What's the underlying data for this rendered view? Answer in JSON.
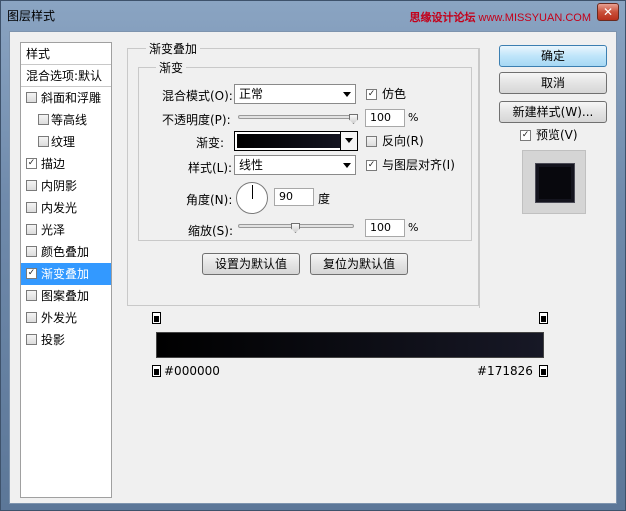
{
  "window": {
    "title": "图层样式",
    "watermark_cn": "思缘设计论坛",
    "watermark_domain": "www.MISSYUAN.COM",
    "close_glyph": "✕"
  },
  "style_list": {
    "header": "样式",
    "blend_options": "混合选项:默认",
    "items": [
      {
        "label": "斜面和浮雕",
        "checked": false
      },
      {
        "label": "等高线",
        "checked": false,
        "sub": true
      },
      {
        "label": "纹理",
        "checked": false,
        "sub": true
      },
      {
        "label": "描边",
        "checked": true
      },
      {
        "label": "内阴影",
        "checked": false
      },
      {
        "label": "内发光",
        "checked": false
      },
      {
        "label": "光泽",
        "checked": false
      },
      {
        "label": "颜色叠加",
        "checked": false
      },
      {
        "label": "渐变叠加",
        "checked": true,
        "active": true
      },
      {
        "label": "图案叠加",
        "checked": false
      },
      {
        "label": "外发光",
        "checked": false
      },
      {
        "label": "投影",
        "checked": false
      }
    ]
  },
  "panel": {
    "outer_title": "渐变叠加",
    "inner_title": "渐变",
    "blend_mode_label": "混合模式(O):",
    "blend_mode_value": "正常",
    "dither_label": "仿色",
    "dither_checked": true,
    "opacity_label": "不透明度(P):",
    "opacity_value": "100",
    "opacity_unit": "%",
    "opacity_level": 1.0,
    "gradient_label": "渐变:",
    "reverse_label": "反向(R)",
    "reverse_checked": false,
    "style_label": "样式(L):",
    "style_value": "线性",
    "align_label": "与图层对齐(I)",
    "align_checked": true,
    "angle_label": "角度(N):",
    "angle_value": "90",
    "angle_unit": "度",
    "scale_label": "缩放(S):",
    "scale_value": "100",
    "scale_unit": "%",
    "scale_level": 0.5,
    "set_default_btn": "设置为默认值",
    "reset_default_btn": "复位为默认值"
  },
  "right": {
    "ok_btn": "确定",
    "cancel_btn": "取消",
    "new_style_btn": "新建样式(W)...",
    "preview_label": "预览(V)",
    "preview_checked": true
  },
  "gradient_editor": {
    "left_color_label": "#000000",
    "right_color_label": "#171826",
    "left_color": "#000000",
    "right_color": "#171826"
  },
  "check_glyph": "✓"
}
